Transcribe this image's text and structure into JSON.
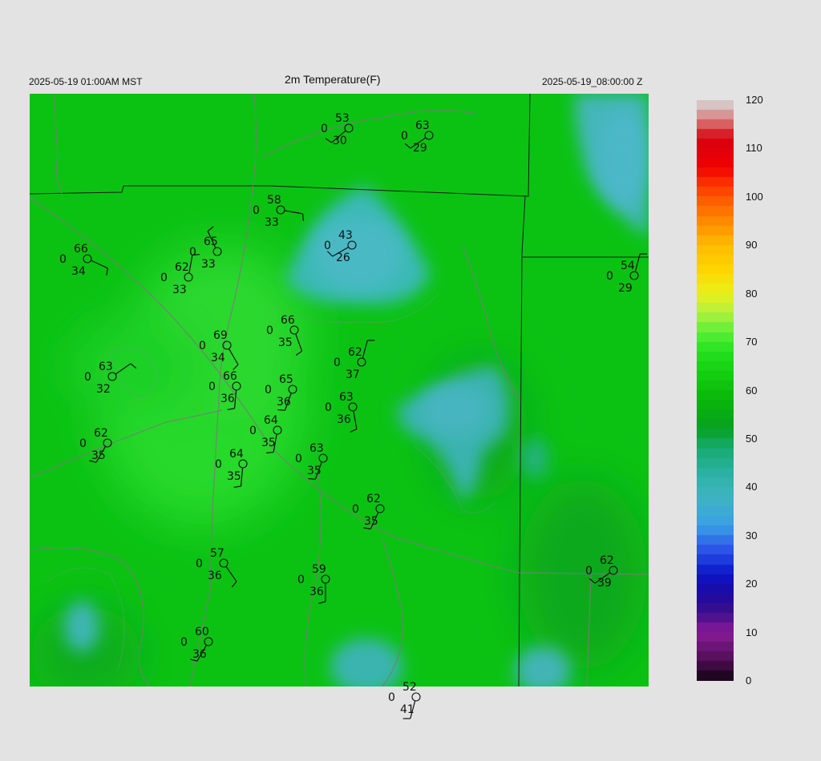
{
  "header": {
    "local_time": "2025-05-19 01:00AM MST",
    "title": "2m Temperature(F)",
    "utc_time": "2025-05-19_08:00:00 Z"
  },
  "colorbar": {
    "min": 0,
    "max": 120,
    "labels": [
      "120",
      "110",
      "100",
      "90",
      "80",
      "70",
      "60",
      "50",
      "40",
      "30",
      "20",
      "10",
      "0"
    ],
    "stops": [
      {
        "v": 0,
        "c": "#120312"
      },
      {
        "v": 5,
        "c": "#5a1060"
      },
      {
        "v": 10,
        "c": "#8a1a9a"
      },
      {
        "v": 14,
        "c": "#3c0f8a"
      },
      {
        "v": 18,
        "c": "#1d0aa0"
      },
      {
        "v": 22,
        "c": "#0a14c8"
      },
      {
        "v": 27,
        "c": "#2b55e8"
      },
      {
        "v": 32,
        "c": "#3aa0e6"
      },
      {
        "v": 38,
        "c": "#3fb4c0"
      },
      {
        "v": 43,
        "c": "#2bb0a2"
      },
      {
        "v": 48,
        "c": "#18aa70"
      },
      {
        "v": 52,
        "c": "#07a020"
      },
      {
        "v": 58,
        "c": "#0ab60a"
      },
      {
        "v": 63,
        "c": "#14cc10"
      },
      {
        "v": 68,
        "c": "#24e020"
      },
      {
        "v": 72,
        "c": "#5aee38"
      },
      {
        "v": 76,
        "c": "#b4f040"
      },
      {
        "v": 80,
        "c": "#eaf018"
      },
      {
        "v": 85,
        "c": "#ffd400"
      },
      {
        "v": 90,
        "c": "#ffbb00"
      },
      {
        "v": 94,
        "c": "#ff9300"
      },
      {
        "v": 98,
        "c": "#ff6a00"
      },
      {
        "v": 102,
        "c": "#ff3a00"
      },
      {
        "v": 106,
        "c": "#f00000"
      },
      {
        "v": 112,
        "c": "#d80010"
      },
      {
        "v": 115,
        "c": "#d86060"
      },
      {
        "v": 118,
        "c": "#d8b0b0"
      },
      {
        "v": 120,
        "c": "#d8d8d8"
      }
    ]
  },
  "map": {
    "base_color": "#0bc213",
    "warm_color": "#22d42c",
    "cool_color": "#3fb3b8",
    "border_color": "#1a1a1a",
    "road_color": "#7a7a7a"
  },
  "stations": [
    {
      "temp": "53",
      "dew": "30",
      "gust": "0"
    },
    {
      "temp": "63",
      "dew": "29",
      "gust": "0"
    },
    {
      "temp": "58",
      "dew": "33",
      "gust": "0"
    },
    {
      "temp": "43",
      "dew": "26",
      "gust": "0"
    },
    {
      "temp": "66",
      "dew": "34",
      "gust": "0"
    },
    {
      "temp": "65",
      "dew": "33",
      "gust": "0"
    },
    {
      "temp": "62",
      "dew": "33",
      "gust": "0"
    },
    {
      "temp": "54",
      "dew": "29",
      "gust": "0"
    },
    {
      "temp": "66",
      "dew": "35",
      "gust": "0"
    },
    {
      "temp": "69",
      "dew": "34",
      "gust": "0"
    },
    {
      "temp": "62",
      "dew": "37",
      "gust": "0"
    },
    {
      "temp": "63",
      "dew": "32",
      "gust": "0"
    },
    {
      "temp": "66",
      "dew": "36",
      "gust": "0"
    },
    {
      "temp": "65",
      "dew": "36",
      "gust": "0"
    },
    {
      "temp": "63",
      "dew": "36",
      "gust": "0"
    },
    {
      "temp": "64",
      "dew": "35",
      "gust": "0"
    },
    {
      "temp": "62",
      "dew": "35",
      "gust": "0"
    },
    {
      "temp": "64",
      "dew": "35",
      "gust": "0"
    },
    {
      "temp": "63",
      "dew": "35",
      "gust": "0"
    },
    {
      "temp": "62",
      "dew": "35",
      "gust": "0"
    },
    {
      "temp": "57",
      "dew": "36",
      "gust": "0"
    },
    {
      "temp": "59",
      "dew": "36",
      "gust": "0"
    },
    {
      "temp": "62",
      "dew": "39",
      "gust": "0"
    },
    {
      "temp": "60",
      "dew": "36",
      "gust": "0"
    },
    {
      "temp": "52",
      "dew": "41",
      "gust": "0"
    }
  ]
}
